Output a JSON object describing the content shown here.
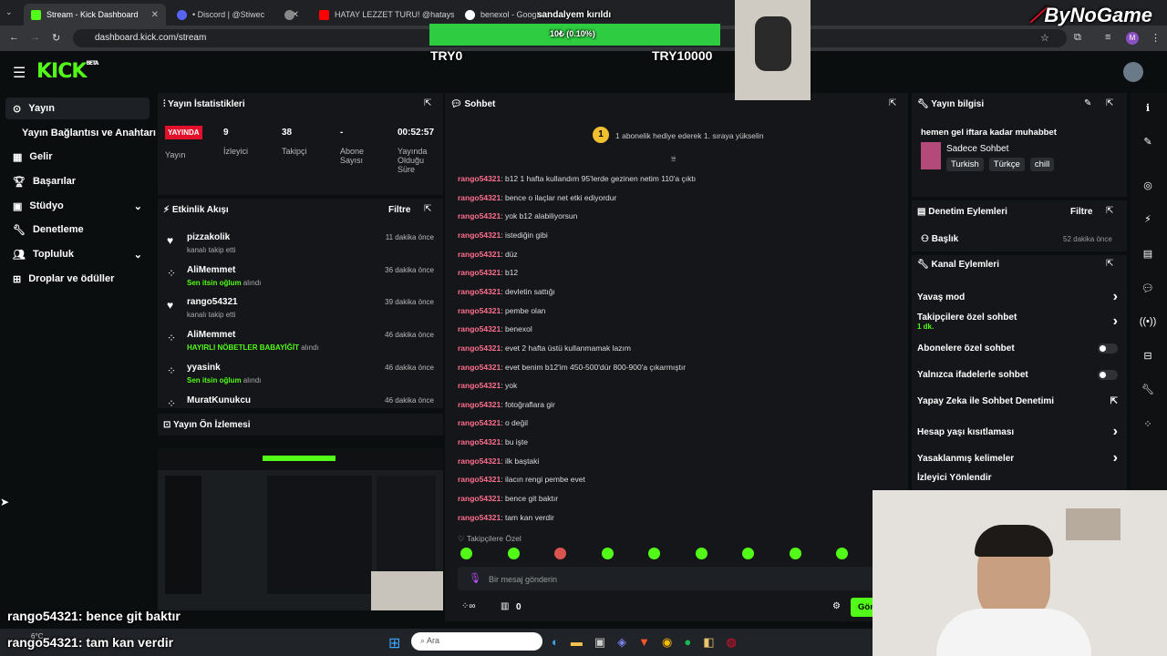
{
  "browser": {
    "tabs": [
      {
        "label": "Stream - Kick Dashboard",
        "color": "#53fc18",
        "active": true
      },
      {
        "label": "• Discord | @Stiwec",
        "color": "#5865f2"
      },
      {
        "label": "",
        "color": "#888888"
      },
      {
        "label": "HATAY LEZZET TURU! @hatays...",
        "color": "#ff0000"
      },
      {
        "label": "benexol - Google'da Ara",
        "color": "#ffffff"
      }
    ],
    "url": "dashboard.kick.com/stream"
  },
  "overlay": {
    "goal_title": "sandalyem kırıldı",
    "goal_progress_text": "10₺ (0.10%)",
    "goal_progress_fraction": 0.001,
    "goal_min": "TRY0",
    "goal_max": "TRY10000",
    "brand": "ByNoGame",
    "chat_lines": [
      {
        "user": "rango54321",
        "msg": ": bence git baktır"
      },
      {
        "user": "rango54321",
        "msg": ": tam kan verdir"
      }
    ]
  },
  "kick": {
    "logo": "KICK",
    "logo_sup": "BETA"
  },
  "sidebar": {
    "items": [
      {
        "label": "Yayın",
        "icon": "broadcast-icon"
      },
      {
        "label": "Yayın Bağlantısı ve Anahtarı",
        "icon": ""
      },
      {
        "label": "Gelir",
        "icon": "revenue-icon"
      },
      {
        "label": "Başarılar",
        "icon": "trophy-icon"
      },
      {
        "label": "Stüdyo",
        "icon": "studio-icon"
      },
      {
        "label": "Denetleme",
        "icon": "wrench-icon"
      },
      {
        "label": "Topluluk",
        "icon": "community-icon"
      },
      {
        "label": "Droplar ve ödüller",
        "icon": "drops-icon"
      }
    ]
  },
  "stats": {
    "title": "Yayın İstatistikleri",
    "live_badge": "YAYINDA",
    "live_label": "Yayın",
    "viewers_value": "9",
    "viewers_label": "İzleyici",
    "followers_value": "38",
    "followers_label": "Takipçi",
    "subs_value": "-",
    "subs_label": "Abone Sayısı",
    "duration_value": "00:52:57",
    "duration_label": "Yayında Olduğu Süre"
  },
  "activity": {
    "title": "Etkinlik Akışı",
    "filter": "Filtre",
    "events": [
      {
        "name": "pizzakolik",
        "detail": "kanalı takip etti",
        "highlight": "",
        "time": "11 dakika önce",
        "icon": "heart-icon"
      },
      {
        "name": "AliMemmet",
        "detail": "alındı",
        "highlight": "Sen itsin oğlum",
        "time": "36 dakika önce",
        "icon": "channel-points-icon"
      },
      {
        "name": "rango54321",
        "detail": "kanalı takip etti",
        "highlight": "",
        "time": "39 dakika önce",
        "icon": "heart-icon"
      },
      {
        "name": "AliMemmet",
        "detail": "alındı",
        "highlight": "HAYIRLI NÖBETLER BABAYİĞİT",
        "time": "46 dakika önce",
        "icon": "channel-points-icon"
      },
      {
        "name": "yyasink",
        "detail": "alındı",
        "highlight": "Sen itsin oğlum",
        "time": "46 dakika önce",
        "icon": "channel-points-icon"
      },
      {
        "name": "MuratKunukcu",
        "detail": "",
        "highlight": "",
        "time": "46 dakika önce",
        "icon": "channel-points-icon"
      }
    ]
  },
  "preview": {
    "title": "Yayın Ön İzlemesi"
  },
  "chat": {
    "title": "Sohbet",
    "pinned_badge": "1",
    "pinned_text": "1 abonelik hediye ederek 1. sıraya yükselin",
    "messages": [
      {
        "user": "rango54321",
        "msg": ": b12 1 hafta kullandım 95'lerde gezinen netim 110'a çıktı"
      },
      {
        "user": "rango54321",
        "msg": ": bence o ilaçlar net etki ediyordur"
      },
      {
        "user": "rango54321",
        "msg": ": yok b12 alabiliyorsun"
      },
      {
        "user": "rango54321",
        "msg": ": istediğin gibi"
      },
      {
        "user": "rango54321",
        "msg": ": düz"
      },
      {
        "user": "rango54321",
        "msg": ": b12"
      },
      {
        "user": "rango54321",
        "msg": ": devletin sattığı"
      },
      {
        "user": "rango54321",
        "msg": ": pembe olan"
      },
      {
        "user": "rango54321",
        "msg": ": benexol"
      },
      {
        "user": "rango54321",
        "msg": ": evet 2 hafta üstü kullanmamak lazım"
      },
      {
        "user": "rango54321",
        "msg": ": evet benim b12'im 450-500'dür 800-900'a çıkarmıştır"
      },
      {
        "user": "rango54321",
        "msg": ": yok"
      },
      {
        "user": "rango54321",
        "msg": ": fotoğraflara gir"
      },
      {
        "user": "rango54321",
        "msg": ": o değil"
      },
      {
        "user": "rango54321",
        "msg": ": bu işte"
      },
      {
        "user": "rango54321",
        "msg": ": ilk baştaki"
      },
      {
        "user": "rango54321",
        "msg": ": ilacın rengi pembe evet"
      },
      {
        "user": "rango54321",
        "msg": ": bence git baktır"
      },
      {
        "user": "rango54321",
        "msg": ": tam kan verdir"
      }
    ],
    "followers_only_label": "Takipçilere Özel",
    "input_placeholder": "Bir mesaj gönderin",
    "points_count": "0",
    "send_label": "Gön"
  },
  "info": {
    "title": "Yayın bilgisi",
    "stream_title": "hemen gel iftara kadar muhabbet",
    "category": "Sadece Sohbet",
    "tags": [
      "Turkish",
      "Türkçe",
      "chill"
    ]
  },
  "mod_actions": {
    "title": "Denetim Eylemleri",
    "filter": "Filtre",
    "item_label": "Başlık",
    "item_time": "52 dakika önce"
  },
  "channel_actions": {
    "title": "Kanal Eylemleri",
    "items": [
      {
        "label": "Yavaş mod",
        "sub": "",
        "control": "chevron"
      },
      {
        "label": "Takipçilere özel sohbet",
        "sub": "1 dk.",
        "control": "chevron"
      },
      {
        "label": "Abonelere özel sohbet",
        "sub": "",
        "control": "toggle"
      },
      {
        "label": "Yalnızca ifadelerle sohbet",
        "sub": "",
        "control": "toggle"
      },
      {
        "label": "Yapay Zeka ile Sohbet Denetimi",
        "sub": "",
        "control": "external"
      },
      {
        "label": "Hesap yaşı kısıtlaması",
        "sub": "",
        "control": "chevron"
      },
      {
        "label": "Yasaklanmış kelimeler",
        "sub": "",
        "control": "chevron"
      },
      {
        "label": "İzleyici Yönlendir",
        "sub": "",
        "control": "none"
      }
    ]
  },
  "taskbar": {
    "weather": "6°C",
    "search_placeholder": "Ara"
  }
}
